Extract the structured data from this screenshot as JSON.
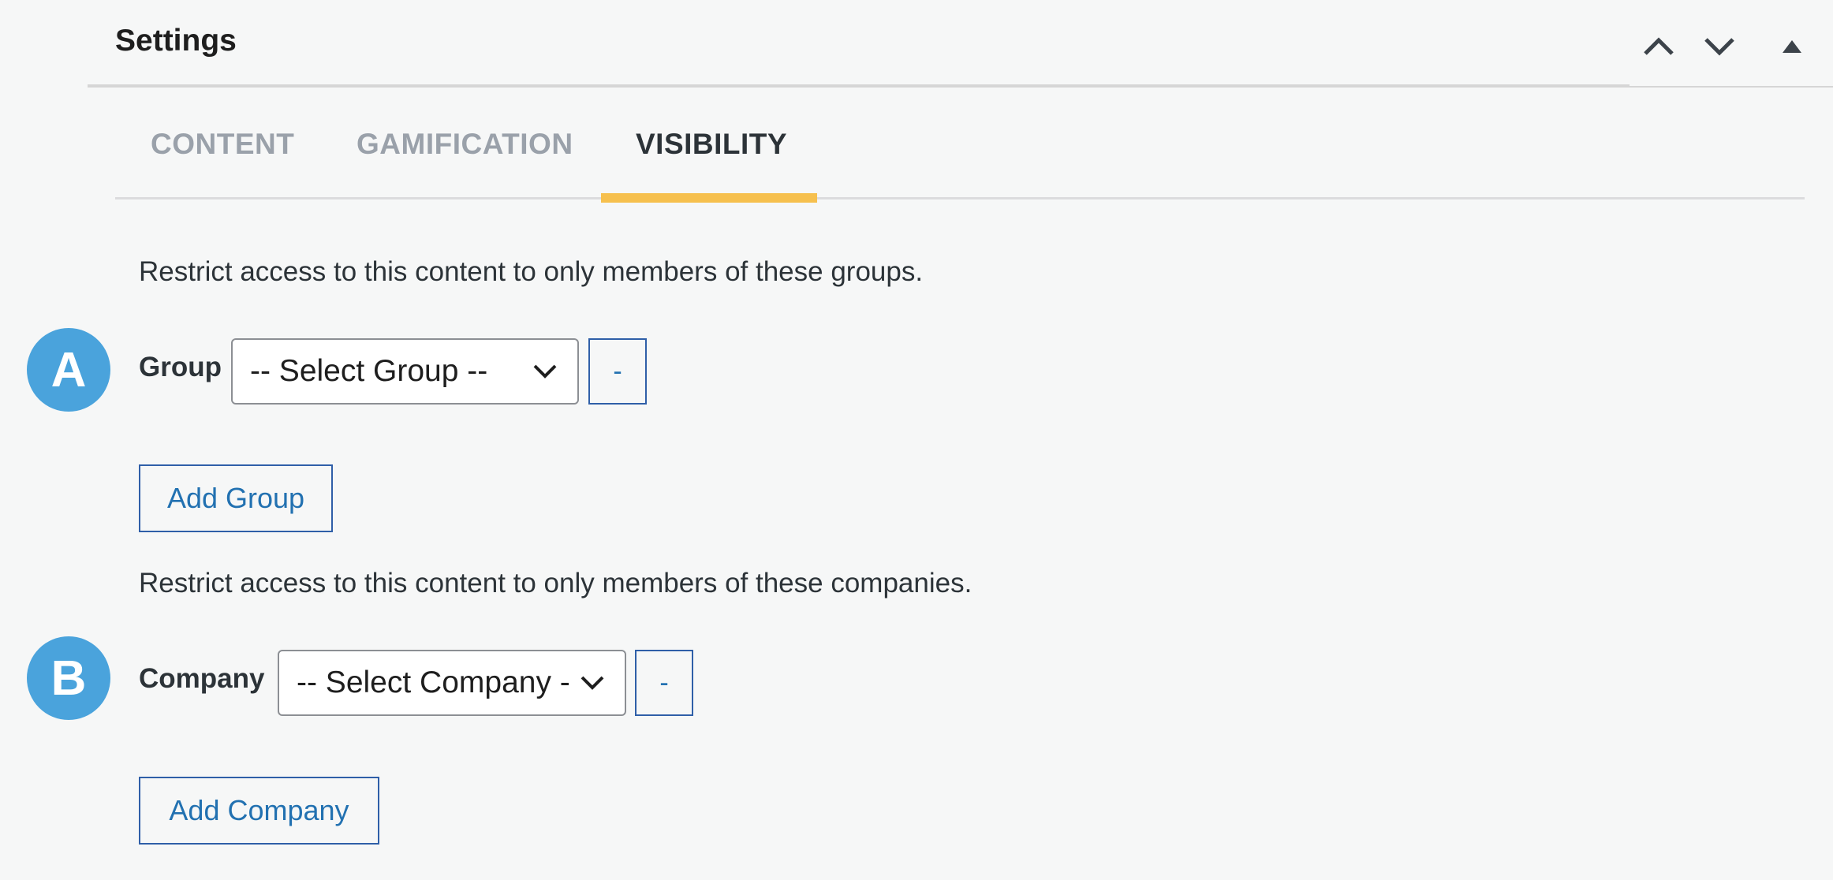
{
  "panel": {
    "title": "Settings"
  },
  "header_controls": {
    "move_up": "chevron-up-icon",
    "move_down": "chevron-down-icon",
    "collapse": "triangle-up-icon"
  },
  "tabs": [
    {
      "label": "CONTENT",
      "active": false
    },
    {
      "label": "GAMIFICATION",
      "active": false
    },
    {
      "label": "VISIBILITY",
      "active": true
    }
  ],
  "groups": {
    "description": "Restrict access to this content to only members of these groups.",
    "marker": "A",
    "label": "Group",
    "select_value": "-- Select Group --",
    "remove_label": "-",
    "add_label": "Add Group"
  },
  "companies": {
    "description": "Restrict access to this content to only members of these companies.",
    "marker": "B",
    "label": "Company",
    "select_value": "-- Select Company --",
    "remove_label": "-",
    "add_label": "Add Company"
  },
  "colors": {
    "accent_tab": "#f6c04e",
    "marker_bg": "#4aa3dc",
    "button_text": "#2271b1",
    "button_border": "#2f5fa8"
  }
}
